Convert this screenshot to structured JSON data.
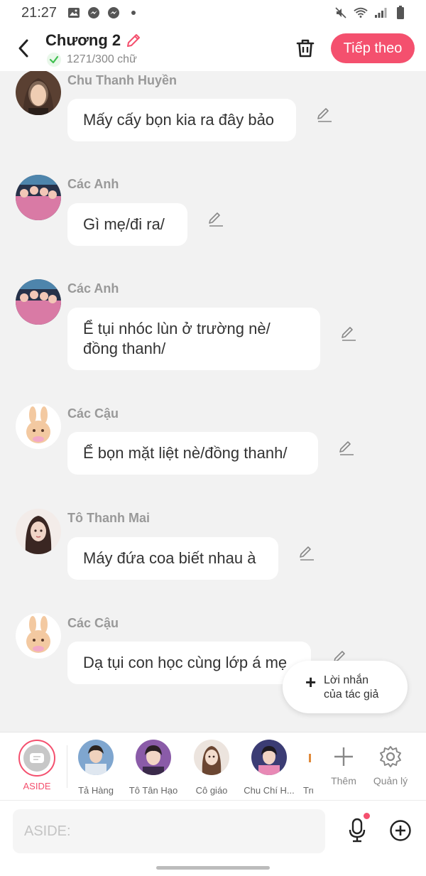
{
  "status_bar": {
    "time": "21:27",
    "left_icons": [
      "gallery-icon",
      "messenger-icon",
      "messenger-icon",
      "dot-icon"
    ],
    "right_icons": [
      "mute-icon",
      "wifi-icon",
      "signal-icon",
      "battery-icon"
    ]
  },
  "header": {
    "title": "Chương 2",
    "word_count": "1271/300 chữ",
    "next_label": "Tiếp theo",
    "accent_color": "#f4506e"
  },
  "messages": [
    {
      "name": "Chu Thanh Huyền",
      "text": "Mấy cấy bọn kia ra đây bảo",
      "avatar": "woman-portrait"
    },
    {
      "name": "Các Anh",
      "text": "Gì mẹ/đi ra/",
      "avatar": "group-photo"
    },
    {
      "name": "Các Anh",
      "text": "Ể tụi nhóc lùn ở trường nè/\nđồng thanh/",
      "avatar": "group-photo"
    },
    {
      "name": "Các Cậu",
      "text": "Ể bọn mặt liệt nè/đồng thanh/",
      "avatar": "bunny-sticker"
    },
    {
      "name": "Tô Thanh Mai",
      "text": "Máy đứa coa biết nhau à",
      "avatar": "anime-girl"
    },
    {
      "name": "Các Cậu",
      "text": "Dạ tụi con học cùng lớp á mẹ",
      "avatar": "bunny-sticker"
    }
  ],
  "fab": {
    "label": "Lời nhắn\ncủa tác giả"
  },
  "characters": [
    {
      "label": "ASIDE"
    },
    {
      "label": "Tả Hàng"
    },
    {
      "label": "Tô Tân Hạo"
    },
    {
      "label": "Cô giáo"
    },
    {
      "label": "Chu Chí H..."
    },
    {
      "label": "Trư"
    }
  ],
  "tools": {
    "more_label": "Thêm",
    "manage_label": "Quản lý"
  },
  "input": {
    "placeholder": "ASIDE:"
  }
}
